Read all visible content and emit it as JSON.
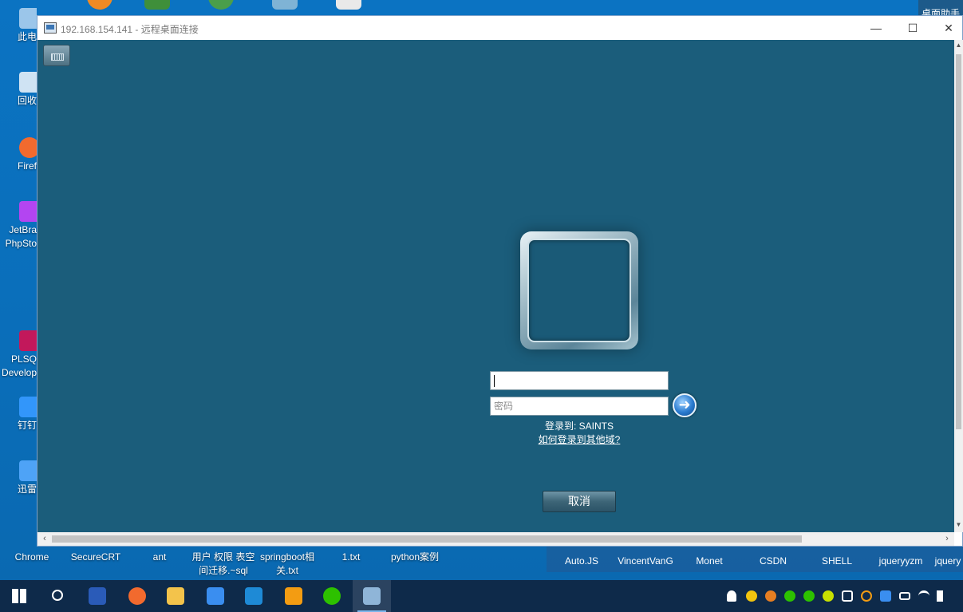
{
  "desktop": {
    "top_icons": [
      "",
      "",
      "",
      "",
      ""
    ],
    "left_icons": [
      {
        "label": "此电",
        "name": "this-pc"
      },
      {
        "label": "回收",
        "name": "recycle-bin"
      },
      {
        "label": "Firef",
        "name": "firefox"
      },
      {
        "label": "JetBra PhpSto",
        "name": "phpstorm"
      },
      {
        "label": "PLSQ Develop",
        "name": "plsql-developer"
      },
      {
        "label": "钉钉",
        "name": "dingtalk"
      },
      {
        "label": "迅雷",
        "name": "thunder"
      }
    ],
    "bottom_icons": [
      {
        "label": "Chrome"
      },
      {
        "label": "SecureCRT"
      },
      {
        "label": "ant"
      },
      {
        "label": "用户 权限 表空间迁移.~sql"
      },
      {
        "label": "springboot相关.txt"
      },
      {
        "label": "1.txt"
      },
      {
        "label": "python案例"
      }
    ],
    "helper_label": "桌面助手",
    "folders": [
      "Auto.JS",
      "VincentVanG",
      "Monet",
      "CSDN",
      "SHELL",
      "jqueryyzm",
      "jquery"
    ]
  },
  "rdp": {
    "title": "192.168.154.141 - 远程桌面连接",
    "minimize": "—",
    "maximize": "☐",
    "close": "✕",
    "login": {
      "username_value": "",
      "password_placeholder": "密码",
      "login_to": "登录到: SAINTS",
      "other_domain_link": "如何登录到其他域?",
      "cancel_label": "取消",
      "submit_arrow": "➜"
    }
  },
  "taskbar": {
    "apps": [
      "windows-start",
      "powershell",
      "firefox",
      "file-explorer",
      "feishu-docs",
      "vscode",
      "virtualbox",
      "wechat",
      "remote-desktop"
    ],
    "active_app": "remote-desktop"
  },
  "colors": {
    "remote_bg": "#1b5d7b",
    "desktop_bg": "#0a6fbb",
    "taskbar_bg": "#0e2a4a"
  }
}
